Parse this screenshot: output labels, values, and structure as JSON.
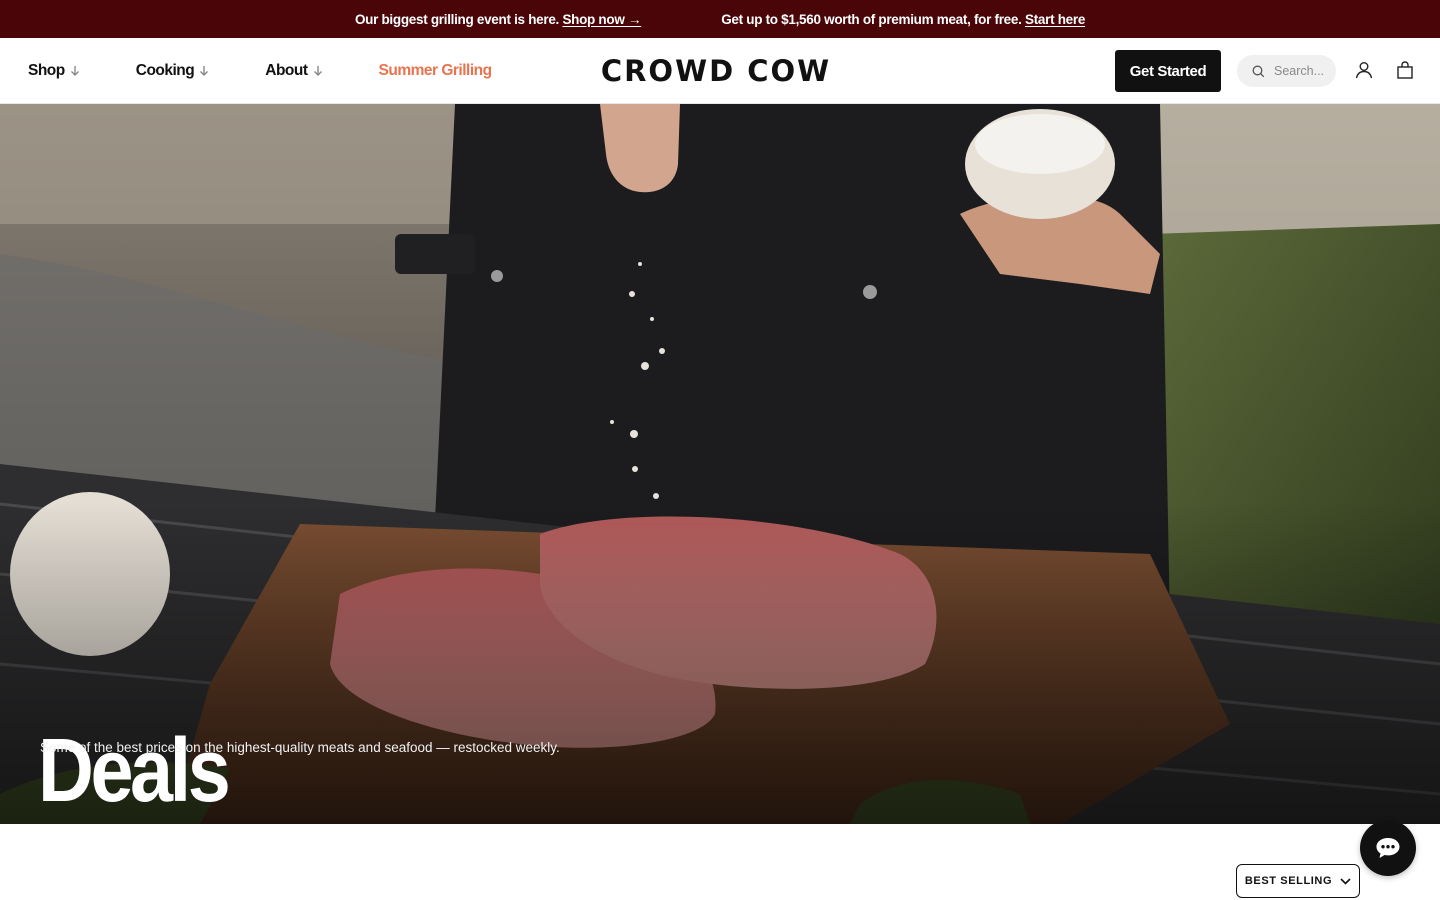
{
  "promo": {
    "left_text": "Our biggest grilling event is here.",
    "left_link": "Shop now",
    "left_link_arrow": "→",
    "right_text": "Get up to $1,560 worth of premium meat, for free.",
    "right_link": "Start here"
  },
  "header": {
    "nav": [
      {
        "label": "Shop",
        "icon": "arrow-down-icon"
      },
      {
        "label": "Cooking",
        "icon": "arrow-down-icon"
      },
      {
        "label": "About",
        "icon": "arrow-down-icon"
      },
      {
        "label": "Summer Grilling"
      }
    ],
    "logo": "CROWD COW",
    "cta_label": "Get Started",
    "search_placeholder": "Search...",
    "icons": [
      "search-icon",
      "user-icon",
      "cart-icon"
    ]
  },
  "hero": {
    "title": "Deals",
    "subtitle": "Some of the best prices on the highest-quality meats and seafood — restocked weekly."
  },
  "sort": {
    "label": "BEST SELLING",
    "icon": "chevron-down-icon"
  },
  "chat": {
    "icon": "chat-bubble-icon"
  },
  "colors": {
    "promo_bg": "#4a0508",
    "accent_orange": "#e8744f",
    "button_dark": "#111111"
  }
}
